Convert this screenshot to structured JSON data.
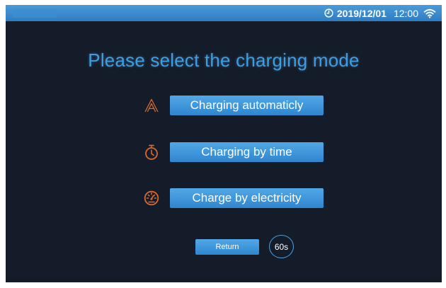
{
  "status_bar": {
    "date": "2019/12/01",
    "time": "12:00"
  },
  "page": {
    "title": "Please select the charging mode"
  },
  "modes": [
    {
      "icon": "letter-a-icon",
      "label": "Charging automaticly"
    },
    {
      "icon": "stopwatch-icon",
      "label": "Charging by time"
    },
    {
      "icon": "gauge-meter-icon",
      "label": "Charge by electricity"
    }
  ],
  "footer": {
    "return_label": "Return",
    "countdown": "60s"
  },
  "colors": {
    "background": "#141b29",
    "status_bar": "#3a88cc",
    "accent_blue": "#3f9de0",
    "icon_orange": "#d9692e",
    "button_text": "#ffffff"
  }
}
